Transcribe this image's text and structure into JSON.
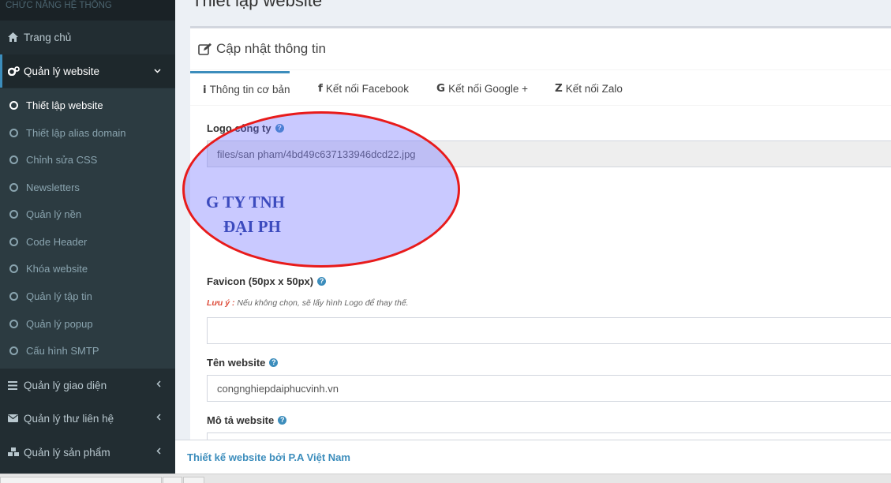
{
  "sidebar": {
    "header": "CHỨC NĂNG HỆ THỐNG",
    "items": [
      {
        "label": "Trang chủ",
        "icon": "home-icon"
      },
      {
        "label": "Quản lý website",
        "icon": "cogs-icon"
      },
      {
        "label": "Quản lý giao diện",
        "icon": "bars-icon"
      },
      {
        "label": "Quản lý thư liên hệ",
        "icon": "envelope-icon"
      },
      {
        "label": "Quản lý sản phẩm",
        "icon": "cubes-icon"
      }
    ],
    "submenu": [
      "Thiết lập website",
      "Thiết lập alias domain",
      "Chỉnh sửa CSS",
      "Newsletters",
      "Quản lý nền",
      "Code Header",
      "Khóa website",
      "Quản lý tập tin",
      "Quản lý popup",
      "Cấu hình SMTP"
    ]
  },
  "page": {
    "title": "Thiết lập website",
    "box_title": "Cập nhật thông tin"
  },
  "tabs": [
    {
      "icon": "i",
      "label": "Thông tin cơ bản"
    },
    {
      "icon": "f",
      "label": "Kết nối Facebook"
    },
    {
      "icon": "G",
      "label": "Kết nối Google +"
    },
    {
      "icon": "Z",
      "label": "Kết nối Zalo"
    }
  ],
  "form": {
    "logo_label": "Logo công ty",
    "logo_value": "files/san pham/4bd49c637133946dcd22.jpg",
    "logo_preview_line1": "G TY TNH",
    "logo_preview_line2": "ĐẠI PH",
    "favicon_label": "Favicon (50px x 50px)",
    "note_prefix": "Lưu ý :",
    "note_text": " Nếu không chọn, sẽ lấy hình Logo để thay thế.",
    "favicon_value": "",
    "site_name_label": "Tên website",
    "site_name_value": "congnghiepdaiphucvinh.vn",
    "description_label": "Mô tả website",
    "help": "?"
  },
  "footer": {
    "text": "Thiết kế website bởi P.A Việt Nam"
  },
  "colors": {
    "sidebar_bg": "#222d32",
    "submenu_bg": "#2c3b41",
    "accent": "#3c8dbc",
    "annotation_ellipse": "#e81b1b"
  }
}
